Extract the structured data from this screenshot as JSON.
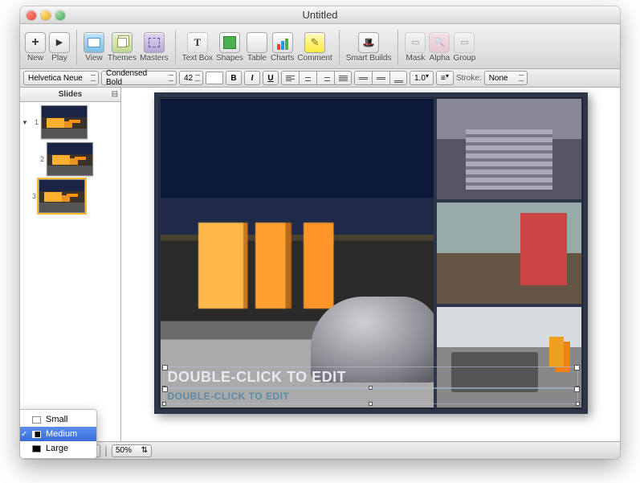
{
  "window": {
    "title": "Untitled"
  },
  "toolbar": {
    "new": "New",
    "play": "Play",
    "view": "View",
    "themes": "Themes",
    "masters": "Masters",
    "textbox": "Text Box",
    "shapes": "Shapes",
    "table": "Table",
    "charts": "Charts",
    "comment": "Comment",
    "smartbuilds": "Smart Builds",
    "mask": "Mask",
    "alpha": "Alpha",
    "group": "Group"
  },
  "format": {
    "font_family": "Helvetica Neue",
    "font_style": "Condensed Bold",
    "font_size": "42",
    "stroke_width": "1.0",
    "stroke_label": "Stroke:",
    "stroke_value": "None"
  },
  "sidebar": {
    "header": "Slides",
    "slides": [
      {
        "num": "1",
        "selected": false,
        "has_children": true,
        "level": 0
      },
      {
        "num": "2",
        "selected": false,
        "has_children": false,
        "level": 1
      },
      {
        "num": "3",
        "selected": true,
        "has_children": false,
        "level": 0
      }
    ]
  },
  "slide": {
    "title_placeholder": "DOUBLE-CLICK TO EDIT",
    "subtitle_placeholder": "DOUBLE-CLICK TO EDIT"
  },
  "status": {
    "zoom": "50%",
    "menu": {
      "items": [
        {
          "label": "Small",
          "size": "s",
          "selected": false
        },
        {
          "label": "Medium",
          "size": "m",
          "selected": true
        },
        {
          "label": "Large",
          "size": "l",
          "selected": false
        }
      ]
    }
  }
}
